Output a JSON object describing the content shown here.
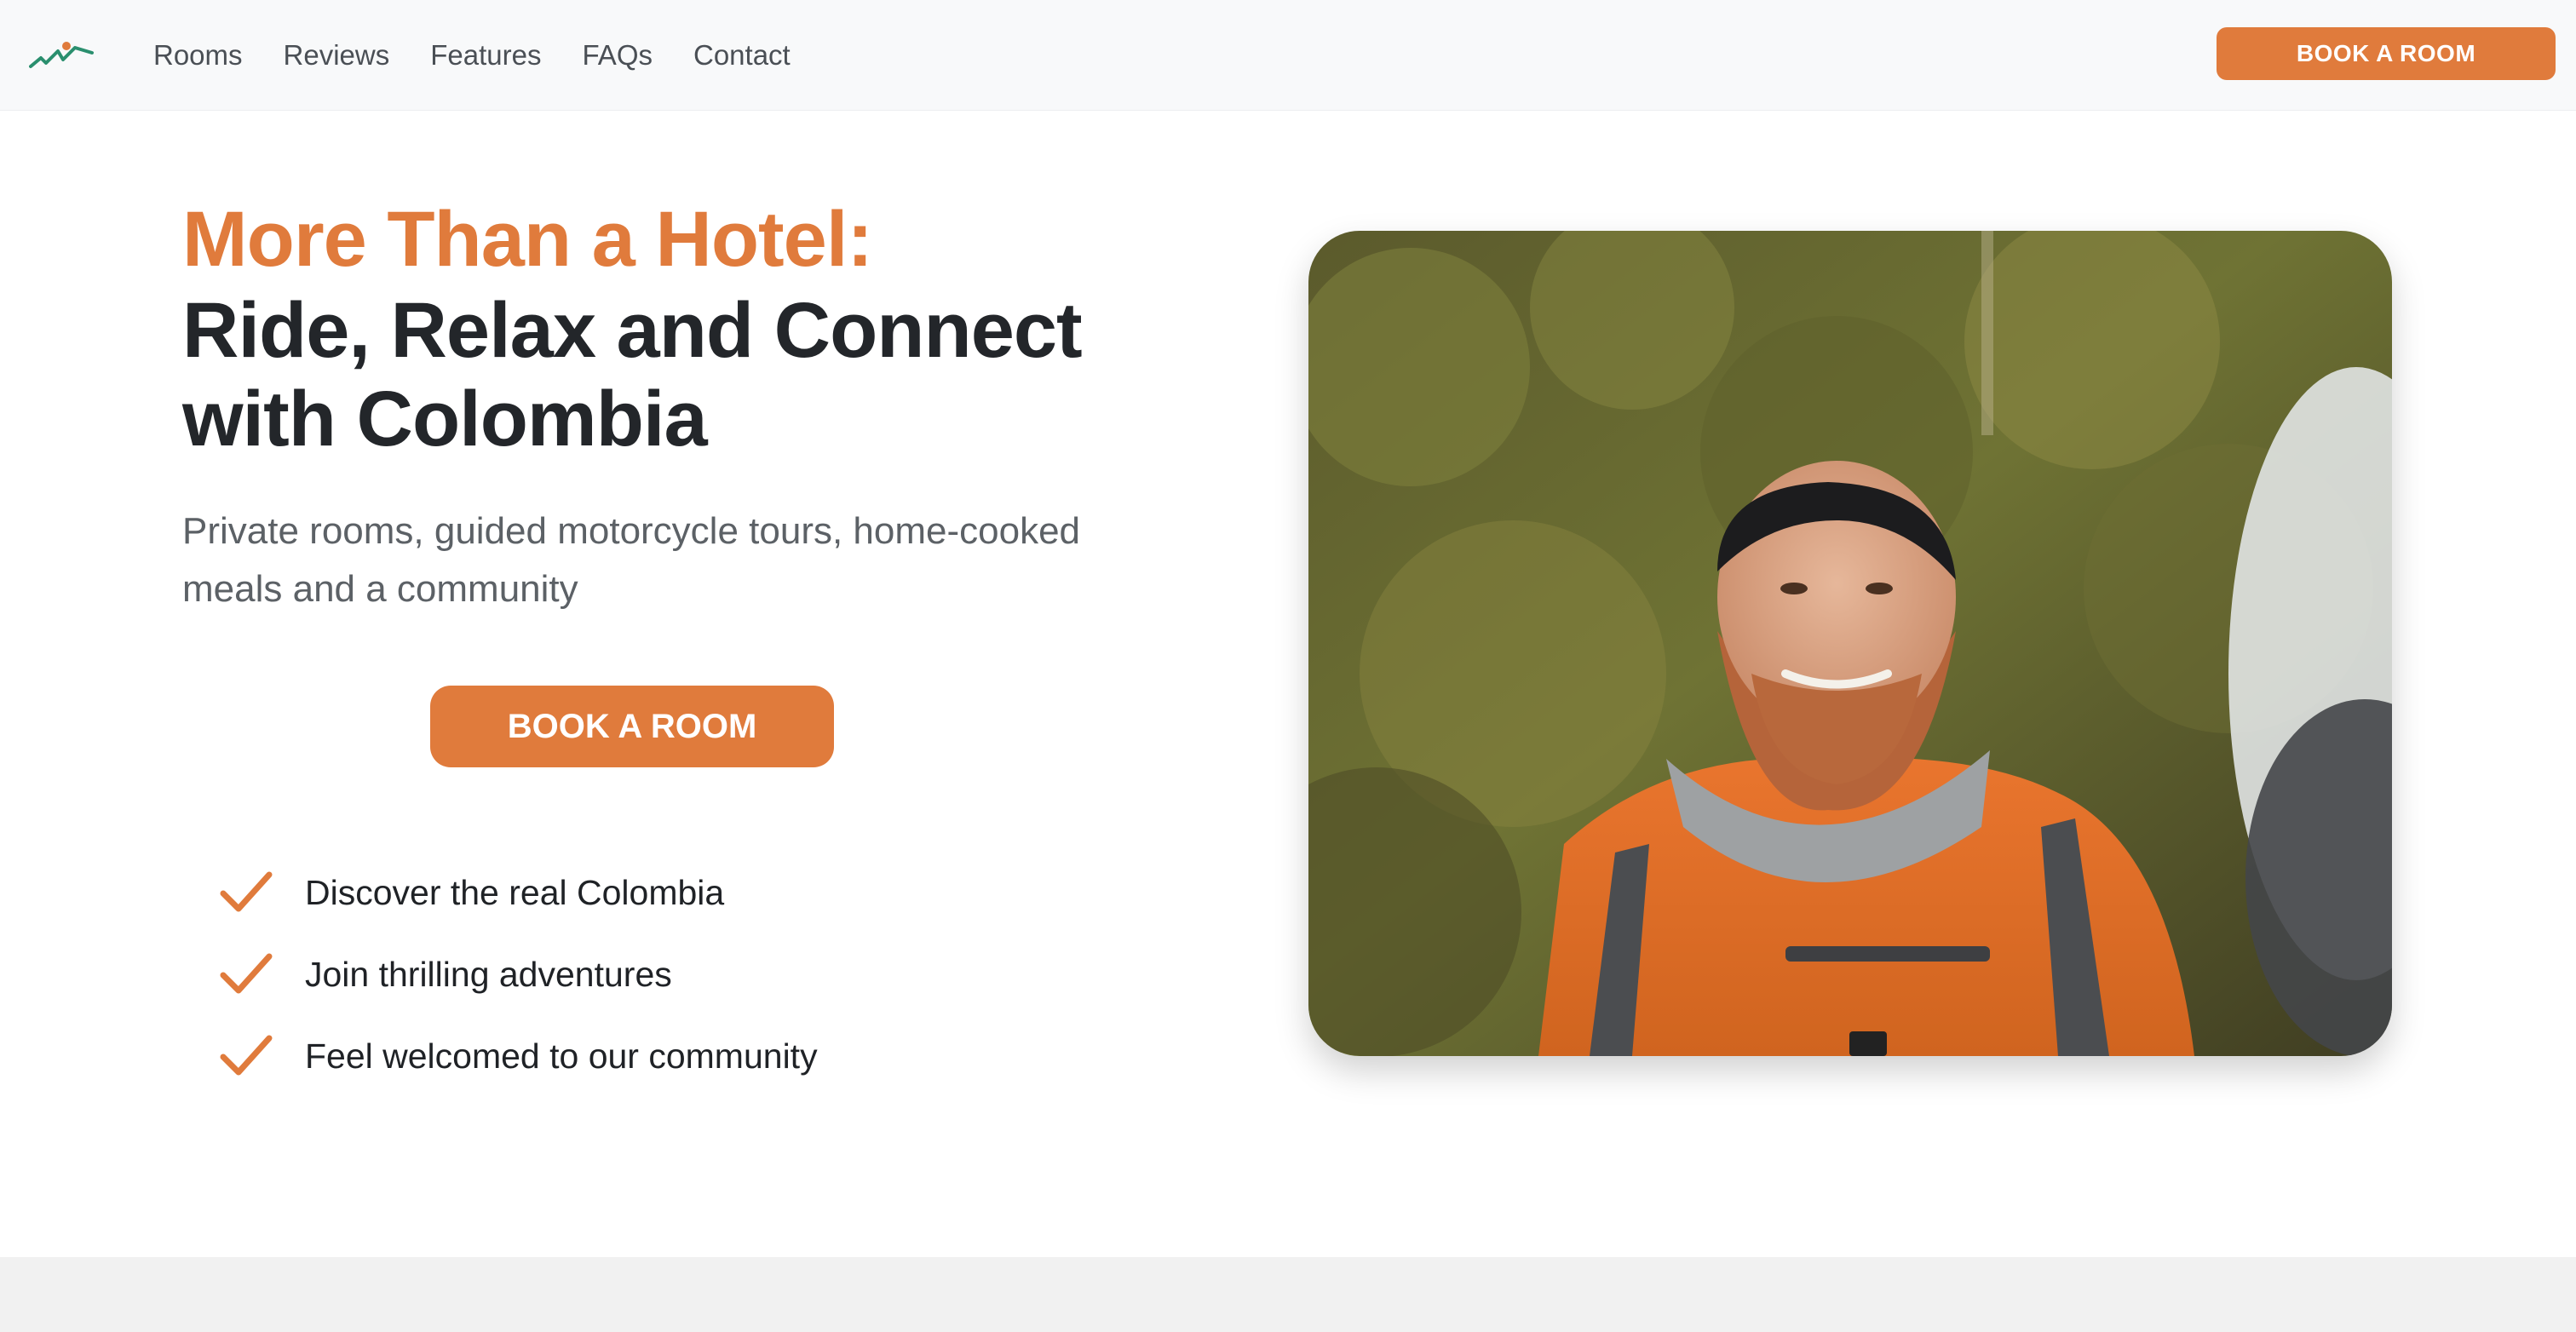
{
  "nav": {
    "logo_icon": "mountain-road-logo-icon",
    "links": [
      "Rooms",
      "Reviews",
      "Features",
      "FAQs",
      "Contact"
    ],
    "book_label": "BOOK A ROOM"
  },
  "hero": {
    "headline_orange": "More Than a Hotel:",
    "headline_line2": "Ride, Relax and Connect",
    "headline_line3": "with Colombia",
    "subtitle": "Private rooms, guided motorcycle tours, home-cooked meals and a community",
    "book_label": "BOOK A ROOM",
    "features": [
      "Discover the real Colombia",
      "Join thrilling adventures",
      "Feel welcomed to our community"
    ],
    "check_icon": "check-icon",
    "photo": "smiling-bearded-motorcyclist-photo"
  },
  "colors": {
    "accent": "#e07b3c",
    "heading": "#23262a",
    "nav_bg": "#f8f9fa",
    "footer_band": "#f1f1f1"
  }
}
